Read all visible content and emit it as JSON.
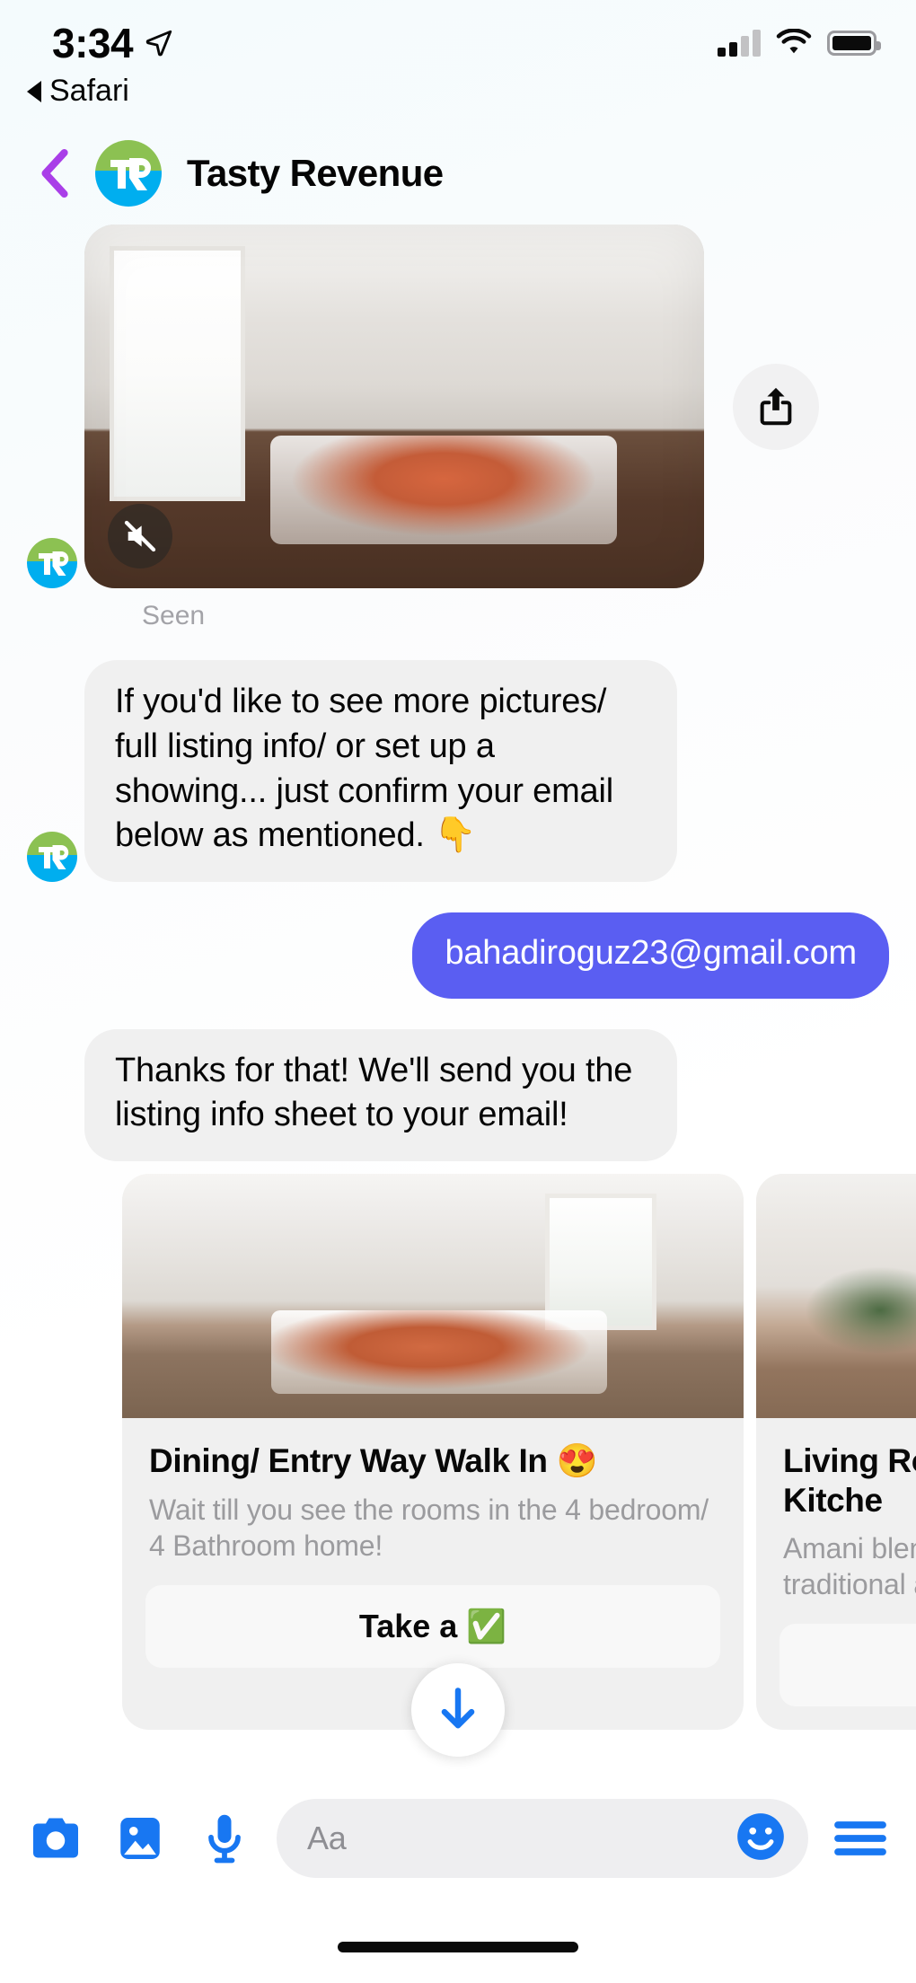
{
  "status_bar": {
    "time": "3:34",
    "location_icon": "location-arrow-icon",
    "signal_icon": "cellular-signal-icon",
    "signal_bars_filled": 2,
    "signal_bars_total": 4,
    "wifi_icon": "wifi-icon",
    "battery_icon": "battery-full-icon"
  },
  "back_to_app": {
    "label": "Safari",
    "icon": "back-triangle-icon"
  },
  "header": {
    "back_icon": "chevron-left-icon",
    "back_color": "#a93ee8",
    "avatar_initials": "TR",
    "avatar_top_color": "#8cc152",
    "avatar_bottom_color": "#00aeef",
    "title": "Tasty Revenue"
  },
  "thread": {
    "video_message": {
      "mute_icon": "speaker-muted-icon",
      "share_icon": "share-upload-icon",
      "status": "Seen"
    },
    "messages": [
      {
        "direction": "incoming",
        "text": "If you'd like to see more pictures/ full listing info/ or set up a showing... just confirm your email below as mentioned. 👇"
      },
      {
        "direction": "outgoing",
        "text": "bahadiroguz23@gmail.com",
        "bubble_color": "#5a5ef2"
      },
      {
        "direction": "incoming",
        "text": "Thanks for that! We'll send you the listing info sheet to your email!"
      }
    ],
    "carousel": [
      {
        "title": "Dining/ Entry Way Walk In 😍",
        "subtitle": "Wait till you see the rooms in the 4 bedroom/ 4 Bathroom home!",
        "button_label": "Take a ✅"
      },
      {
        "title": "Living Ro to Kitche",
        "subtitle": "Amani blen traditional a",
        "button_label": ""
      }
    ]
  },
  "scroll_to_bottom": {
    "icon": "arrow-down-icon",
    "color": "#1877f2"
  },
  "composer": {
    "camera_icon": "camera-icon",
    "gallery_icon": "photo-gallery-icon",
    "mic_icon": "microphone-icon",
    "placeholder": "Aa",
    "emoji_icon": "smiley-face-icon",
    "menu_icon": "hamburger-menu-icon",
    "accent_color": "#1877f2"
  }
}
